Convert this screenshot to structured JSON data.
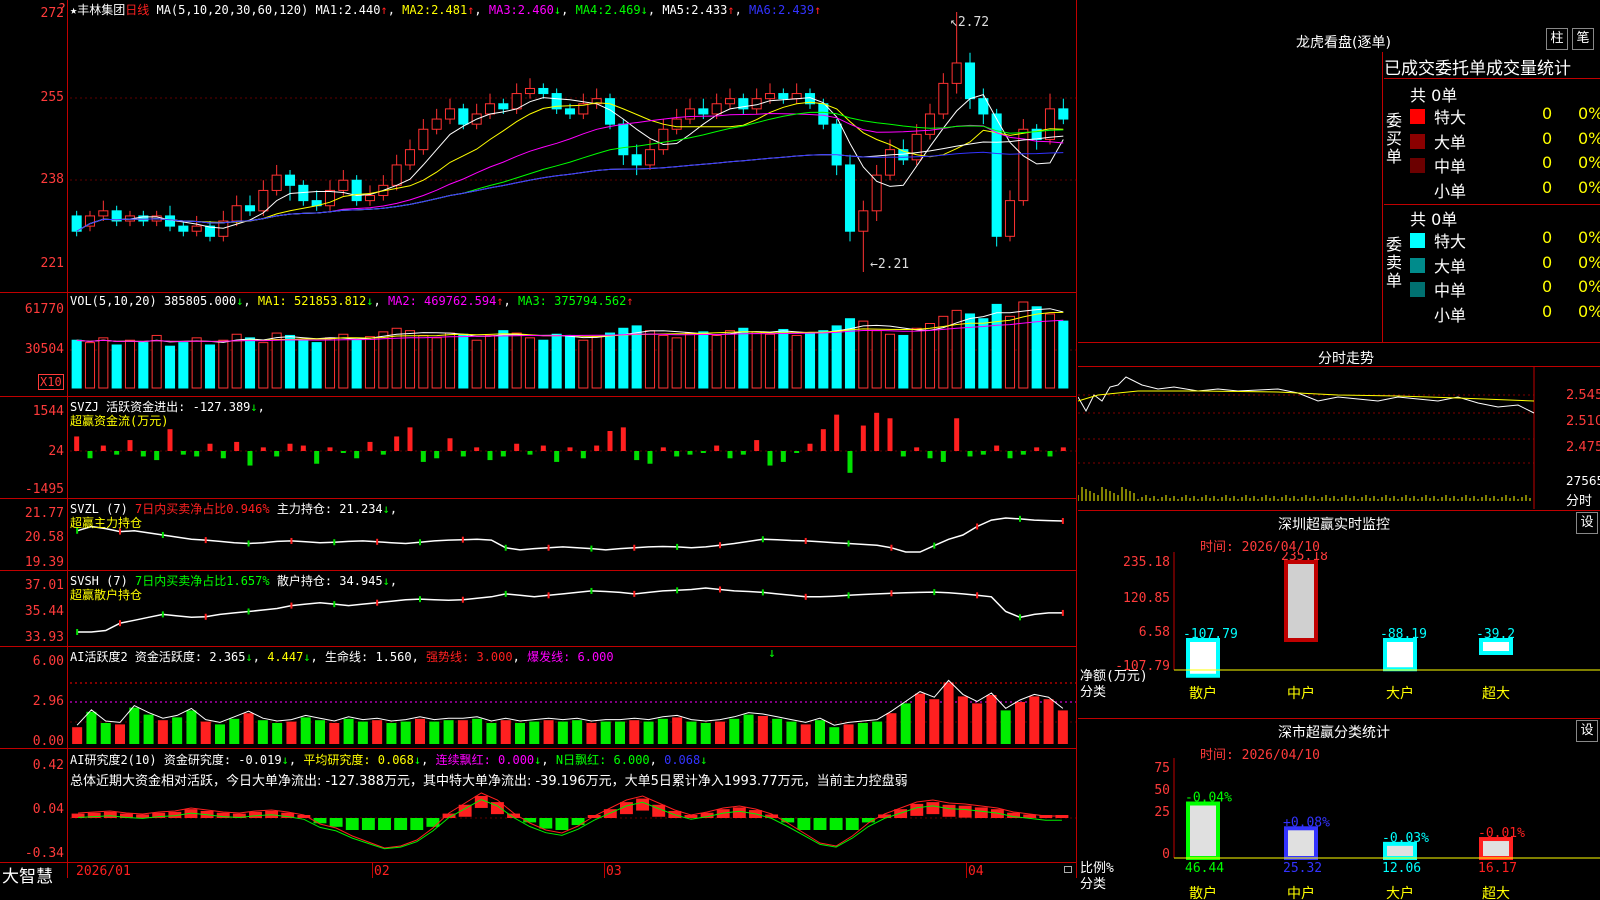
{
  "stock": {
    "name_line": "★丰林集团",
    "period": "日线"
  },
  "main_panel": {
    "ma_header": "MA(5,10,20,30,60,120)",
    "mas": [
      {
        "label": "MA1:",
        "value": "2.440",
        "arrow": "↑",
        "color": "#ffffff"
      },
      {
        "label": "MA2:",
        "value": "2.481",
        "arrow": "↑",
        "color": "#ffff00"
      },
      {
        "label": "MA3:",
        "value": "2.460",
        "arrow": "↓",
        "color": "#ff00ff"
      },
      {
        "label": "MA4:",
        "value": "2.469",
        "arrow": "↓",
        "color": "#00ff00"
      },
      {
        "label": "MA5:",
        "value": "2.433",
        "arrow": "↑",
        "color": "#ffffff"
      },
      {
        "label": "MA6:",
        "value": "2.439",
        "arrow": "↑",
        "color": "#3333ff"
      }
    ],
    "y_ticks": [
      "272",
      "255",
      "238",
      "221"
    ],
    "high_label": "2.72",
    "low_label": "2.21",
    "corner_mark": "?"
  },
  "vol_panel": {
    "header": "VOL(5,10,20)",
    "value": "385805.000",
    "value_arrow": "↓",
    "ma1": "MA1: 521853.812",
    "ma1_arrow": "↓",
    "ma2": "MA2: 469762.594",
    "ma2_arrow": "↑",
    "ma3": "MA3: 375794.562",
    "ma3_arrow": "↑",
    "y_ticks": [
      "61770",
      "30504"
    ],
    "unit": "X10"
  },
  "svzj_panel": {
    "header": "SVZJ",
    "line1": "活跃资金进出: -127.389",
    "arrow": "↓",
    "subtitle": "超赢资金流(万元)",
    "y_ticks": [
      "1544",
      "24",
      "-1495"
    ]
  },
  "svzl_panel": {
    "header": "SVZL (7)",
    "ratio_text": "7日内买卖净占比0.946%",
    "hold_text": "主力持仓: 21.234",
    "arrow": "↓",
    "subtitle": "超赢主力持仓",
    "y_ticks": [
      "21.77",
      "20.58",
      "19.39"
    ]
  },
  "svsh_panel": {
    "header": "SVSH (7)",
    "ratio_text": "7日内买卖净占比1.657%",
    "hold_text": "散户持仓: 34.945",
    "arrow": "↓",
    "subtitle": "超赢散户持仓",
    "y_ticks": [
      "37.01",
      "35.44",
      "33.93"
    ]
  },
  "ai_active_panel": {
    "header": "AI活跃度2",
    "t1": "资金活跃度: 2.365",
    "a1": "↓",
    "t2": "4.447",
    "a2": "↓",
    "t3": "生命线: 1.560",
    "t4": "强势线: 3.000",
    "t5": "爆发线: 6.000",
    "marker": "↓",
    "y_ticks": [
      "6.00",
      "2.96",
      "0.00"
    ]
  },
  "ai_research_panel": {
    "header": "AI研究度2(10)",
    "t1": "资金研究度: -0.019",
    "a1": "↓",
    "t2": "平均研究度: 0.068",
    "a2": "↓",
    "t3": "连续飘红: 0.000",
    "a3": "↓",
    "t4": "N日飘红: 6.000",
    "t5": "0.068",
    "a5": "↓",
    "summary": "总体近期大资金相对活跃，今日大单净流出: -127.388万元，其中特大单净流出: -39.196万元，大单5日累计净入1993.77万元，当前主力控盘弱",
    "y_ticks": [
      "0.42",
      "0.04",
      "-0.34"
    ]
  },
  "bottom_bar": {
    "brand": "大智慧",
    "dates": [
      "2026/01",
      "02",
      "03",
      "04"
    ]
  },
  "right": {
    "lhb_title": "龙虎看盘(逐单)",
    "btn_zhu": "柱",
    "btn_bi": "笔",
    "tabs_line": "已成交委托单成交量统计",
    "buy_label": "委买单",
    "sell_label": "委卖单",
    "buy_total": "共 0单",
    "sell_total": "共 0单",
    "buy_rows": [
      {
        "name": "特大",
        "count": "0",
        "pct": "0%",
        "color": "#ff0000"
      },
      {
        "name": "大单",
        "count": "0",
        "pct": "0%",
        "color": "#8b0000"
      },
      {
        "name": "中单",
        "count": "0",
        "pct": "0%",
        "color": "#6b0000"
      },
      {
        "name": "小单",
        "count": "0",
        "pct": "0%",
        "color": "#000000"
      }
    ],
    "sell_rows": [
      {
        "name": "特大",
        "count": "0",
        "pct": "0%",
        "color": "#00ffff"
      },
      {
        "name": "大单",
        "count": "0",
        "pct": "0%",
        "color": "#008b8b"
      },
      {
        "name": "中单",
        "count": "0",
        "pct": "0%",
        "color": "#007070"
      },
      {
        "name": "小单",
        "count": "0",
        "pct": "0%",
        "color": "#000000"
      }
    ],
    "intraday_title": "分时走势",
    "intraday_ticks": [
      "2.545",
      "2.510",
      "2.475",
      "27565",
      "分时"
    ],
    "sz_monitor": {
      "title": "深圳超赢实时监控",
      "settings": "设",
      "time": "时间: 2026/04/10",
      "y_ticks": [
        "235.18",
        "120.85",
        "6.58",
        "-107.79"
      ],
      "axis_label1": "净额(万元)",
      "axis_label2": "分类",
      "categories": [
        "散户",
        "中户",
        "大户",
        "超大"
      ],
      "values": [
        -107.79,
        235.18,
        -88.19,
        -39.2
      ],
      "value_labels": [
        "-107.79",
        "235.18",
        "-88.19",
        "-39.2"
      ]
    },
    "sz_class": {
      "title": "深市超赢分类统计",
      "settings": "设",
      "time": "时间: 2026/04/10",
      "y_ticks": [
        "75",
        "50",
        "25",
        "0"
      ],
      "axis_label1": "比例%",
      "axis_label2": "分类",
      "categories": [
        "散户",
        "中户",
        "大户",
        "超大"
      ],
      "values": [
        46.44,
        25.32,
        12.06,
        16.17
      ],
      "change_labels": [
        "-0.04%",
        "+0.08%",
        "-0.03%",
        "-0.01%"
      ],
      "value_labels": [
        "46.44",
        "25.32",
        "12.06",
        "16.17"
      ]
    }
  },
  "chart_data": {
    "type": "candlestick",
    "title": "丰林集团 日线",
    "x_labels": [
      "2026/01",
      "02",
      "03",
      "04"
    ],
    "ylim": [
      2.21,
      2.72
    ],
    "candles": [
      [
        2.32,
        2.29,
        2.33,
        2.28
      ],
      [
        2.3,
        2.32,
        2.33,
        2.29
      ],
      [
        2.32,
        2.33,
        2.35,
        2.31
      ],
      [
        2.33,
        2.31,
        2.34,
        2.3
      ],
      [
        2.31,
        2.32,
        2.33,
        2.3
      ],
      [
        2.32,
        2.31,
        2.33,
        2.3
      ],
      [
        2.31,
        2.32,
        2.33,
        2.3
      ],
      [
        2.32,
        2.3,
        2.34,
        2.29
      ],
      [
        2.3,
        2.29,
        2.31,
        2.28
      ],
      [
        2.29,
        2.3,
        2.32,
        2.28
      ],
      [
        2.3,
        2.28,
        2.31,
        2.27
      ],
      [
        2.28,
        2.31,
        2.33,
        2.27
      ],
      [
        2.31,
        2.34,
        2.36,
        2.3
      ],
      [
        2.34,
        2.33,
        2.36,
        2.32
      ],
      [
        2.33,
        2.37,
        2.39,
        2.32
      ],
      [
        2.37,
        2.4,
        2.42,
        2.36
      ],
      [
        2.4,
        2.38,
        2.41,
        2.35
      ],
      [
        2.38,
        2.35,
        2.39,
        2.34
      ],
      [
        2.35,
        2.34,
        2.37,
        2.33
      ],
      [
        2.34,
        2.37,
        2.39,
        2.33
      ],
      [
        2.37,
        2.39,
        2.41,
        2.36
      ],
      [
        2.39,
        2.35,
        2.4,
        2.34
      ],
      [
        2.35,
        2.36,
        2.38,
        2.34
      ],
      [
        2.36,
        2.38,
        2.4,
        2.35
      ],
      [
        2.38,
        2.42,
        2.44,
        2.37
      ],
      [
        2.42,
        2.45,
        2.47,
        2.41
      ],
      [
        2.45,
        2.49,
        2.51,
        2.44
      ],
      [
        2.49,
        2.51,
        2.53,
        2.48
      ],
      [
        2.51,
        2.53,
        2.55,
        2.5
      ],
      [
        2.53,
        2.5,
        2.54,
        2.49
      ],
      [
        2.5,
        2.52,
        2.54,
        2.49
      ],
      [
        2.52,
        2.54,
        2.56,
        2.51
      ],
      [
        2.54,
        2.53,
        2.55,
        2.52
      ],
      [
        2.53,
        2.56,
        2.58,
        2.52
      ],
      [
        2.56,
        2.57,
        2.59,
        2.55
      ],
      [
        2.57,
        2.56,
        2.58,
        2.55
      ],
      [
        2.56,
        2.53,
        2.57,
        2.52
      ],
      [
        2.53,
        2.52,
        2.54,
        2.51
      ],
      [
        2.52,
        2.54,
        2.56,
        2.51
      ],
      [
        2.54,
        2.55,
        2.57,
        2.53
      ],
      [
        2.55,
        2.5,
        2.56,
        2.49
      ],
      [
        2.5,
        2.44,
        2.51,
        2.42
      ],
      [
        2.44,
        2.42,
        2.46,
        2.4
      ],
      [
        2.42,
        2.45,
        2.47,
        2.41
      ],
      [
        2.45,
        2.49,
        2.51,
        2.44
      ],
      [
        2.49,
        2.51,
        2.53,
        2.48
      ],
      [
        2.51,
        2.53,
        2.55,
        2.5
      ],
      [
        2.53,
        2.52,
        2.55,
        2.51
      ],
      [
        2.52,
        2.54,
        2.56,
        2.51
      ],
      [
        2.54,
        2.55,
        2.57,
        2.53
      ],
      [
        2.55,
        2.53,
        2.56,
        2.52
      ],
      [
        2.53,
        2.55,
        2.57,
        2.52
      ],
      [
        2.55,
        2.56,
        2.58,
        2.54
      ],
      [
        2.56,
        2.55,
        2.57,
        2.54
      ],
      [
        2.55,
        2.56,
        2.58,
        2.54
      ],
      [
        2.56,
        2.54,
        2.57,
        2.53
      ],
      [
        2.54,
        2.5,
        2.55,
        2.49
      ],
      [
        2.5,
        2.42,
        2.51,
        2.4
      ],
      [
        2.42,
        2.29,
        2.44,
        2.27
      ],
      [
        2.29,
        2.33,
        2.35,
        2.21
      ],
      [
        2.33,
        2.4,
        2.42,
        2.31
      ],
      [
        2.4,
        2.45,
        2.47,
        2.39
      ],
      [
        2.45,
        2.43,
        2.47,
        2.42
      ],
      [
        2.43,
        2.48,
        2.5,
        2.42
      ],
      [
        2.48,
        2.52,
        2.54,
        2.47
      ],
      [
        2.52,
        2.58,
        2.6,
        2.51
      ],
      [
        2.58,
        2.62,
        2.72,
        2.56
      ],
      [
        2.62,
        2.55,
        2.64,
        2.53
      ],
      [
        2.55,
        2.52,
        2.57,
        2.5
      ],
      [
        2.52,
        2.28,
        2.53,
        2.26
      ],
      [
        2.28,
        2.35,
        2.37,
        2.27
      ],
      [
        2.35,
        2.49,
        2.51,
        2.34
      ],
      [
        2.49,
        2.47,
        2.5,
        2.45
      ],
      [
        2.47,
        2.53,
        2.56,
        2.46
      ],
      [
        2.53,
        2.51,
        2.55,
        2.5
      ]
    ],
    "volume": [
      40,
      38,
      42,
      36,
      40,
      38,
      44,
      35,
      38,
      42,
      36,
      40,
      45,
      42,
      38,
      46,
      44,
      40,
      38,
      42,
      45,
      40,
      43,
      47,
      50,
      48,
      44,
      42,
      46,
      45,
      40,
      44,
      48,
      46,
      42,
      40,
      45,
      44,
      40,
      43,
      46,
      50,
      52,
      48,
      44,
      42,
      46,
      47,
      44,
      48,
      50,
      47,
      45,
      49,
      44,
      46,
      48,
      52,
      58,
      56,
      48,
      45,
      44,
      50,
      54,
      60,
      65,
      62,
      58,
      70,
      60,
      72,
      68,
      62,
      56
    ],
    "active_flow": [
      80,
      -40,
      30,
      -20,
      60,
      -30,
      -50,
      120,
      -20,
      -30,
      40,
      -40,
      50,
      -80,
      20,
      -30,
      40,
      30,
      -70,
      20,
      -10,
      -40,
      50,
      -20,
      80,
      130,
      -60,
      -40,
      70,
      -30,
      20,
      -50,
      -30,
      40,
      -20,
      30,
      -60,
      20,
      -40,
      30,
      110,
      130,
      -50,
      -70,
      20,
      -30,
      -20,
      -10,
      30,
      -40,
      -20,
      60,
      -80,
      -60,
      -10,
      40,
      120,
      200,
      -120,
      140,
      210,
      180,
      -30,
      20,
      -40,
      -60,
      180,
      -30,
      -20,
      30,
      -40,
      -20,
      20,
      -30,
      20
    ],
    "main_hold": [
      21.0,
      21.1,
      21.05,
      20.98,
      21.0,
      20.95,
      20.9,
      20.85,
      20.8,
      20.78,
      20.75,
      20.72,
      20.7,
      20.72,
      20.75,
      20.76,
      20.74,
      20.72,
      20.73,
      20.75,
      20.76,
      20.74,
      20.72,
      20.7,
      20.73,
      20.76,
      20.78,
      20.79,
      20.8,
      20.78,
      20.6,
      20.55,
      20.58,
      20.6,
      20.62,
      20.6,
      20.58,
      20.55,
      20.58,
      20.6,
      20.62,
      20.63,
      20.62,
      20.6,
      20.62,
      20.66,
      20.7,
      20.75,
      20.8,
      20.79,
      20.77,
      20.76,
      20.74,
      20.72,
      20.7,
      20.68,
      20.66,
      20.6,
      20.5,
      20.5,
      20.65,
      20.8,
      20.9,
      21.1,
      21.25,
      21.3,
      21.28,
      21.25,
      21.24,
      21.23
    ],
    "retail_hold": [
      34.3,
      34.3,
      34.35,
      34.6,
      34.7,
      34.8,
      34.9,
      34.85,
      34.8,
      34.82,
      34.9,
      34.95,
      35.0,
      35.05,
      35.1,
      35.2,
      35.25,
      35.3,
      35.25,
      35.2,
      35.25,
      35.3,
      35.35,
      35.4,
      35.42,
      35.4,
      35.38,
      35.4,
      35.45,
      35.5,
      35.6,
      35.55,
      35.5,
      35.55,
      35.6,
      35.65,
      35.7,
      35.68,
      35.65,
      35.6,
      35.65,
      35.7,
      35.72,
      35.75,
      35.8,
      35.75,
      35.7,
      35.68,
      35.65,
      35.6,
      35.55,
      35.5,
      35.5,
      35.52,
      35.55,
      35.58,
      35.6,
      35.62,
      35.64,
      35.65,
      35.66,
      35.64,
      35.6,
      35.55,
      35.5,
      35.0,
      34.8,
      34.9,
      34.95,
      34.95
    ],
    "active_bars": [
      1.2,
      2.3,
      1.5,
      1.4,
      2.6,
      2.1,
      1.7,
      1.9,
      2.4,
      1.6,
      1.4,
      1.8,
      2.2,
      1.7,
      1.5,
      1.6,
      1.9,
      1.7,
      1.5,
      1.8,
      1.6,
      1.7,
      1.5,
      1.6,
      1.8,
      1.6,
      1.7,
      1.7,
      1.8,
      1.5,
      1.7,
      1.5,
      1.6,
      1.7,
      1.6,
      1.7,
      1.5,
      1.6,
      1.6,
      1.7,
      1.6,
      1.8,
      1.9,
      1.6,
      1.5,
      1.6,
      1.8,
      2.1,
      2.0,
      1.8,
      1.6,
      1.4,
      1.7,
      1.2,
      1.4,
      1.5,
      1.6,
      2.2,
      2.9,
      3.6,
      3.2,
      4.4,
      3.4,
      2.9,
      3.5,
      2.4,
      3.0,
      3.4,
      3.2,
      2.4
    ],
    "research": [
      0.05,
      0.06,
      0.07,
      0.05,
      0.04,
      0.06,
      0.07,
      0.1,
      0.08,
      0.06,
      0.05,
      0.07,
      0.08,
      0.06,
      0.03,
      -0.06,
      -0.1,
      -0.18,
      -0.24,
      -0.3,
      -0.28,
      -0.22,
      -0.1,
      0.05,
      0.15,
      0.25,
      0.18,
      0.05,
      -0.05,
      -0.12,
      -0.15,
      -0.08,
      0.02,
      0.1,
      0.18,
      0.22,
      0.15,
      0.08,
      0.03,
      0.06,
      0.1,
      0.12,
      0.09,
      0.04,
      -0.05,
      -0.15,
      -0.25,
      -0.28,
      -0.18,
      -0.05,
      0.04,
      0.1,
      0.16,
      0.18,
      0.15,
      0.14,
      0.12,
      0.1,
      0.06,
      0.04,
      0.02,
      0.02
    ]
  }
}
